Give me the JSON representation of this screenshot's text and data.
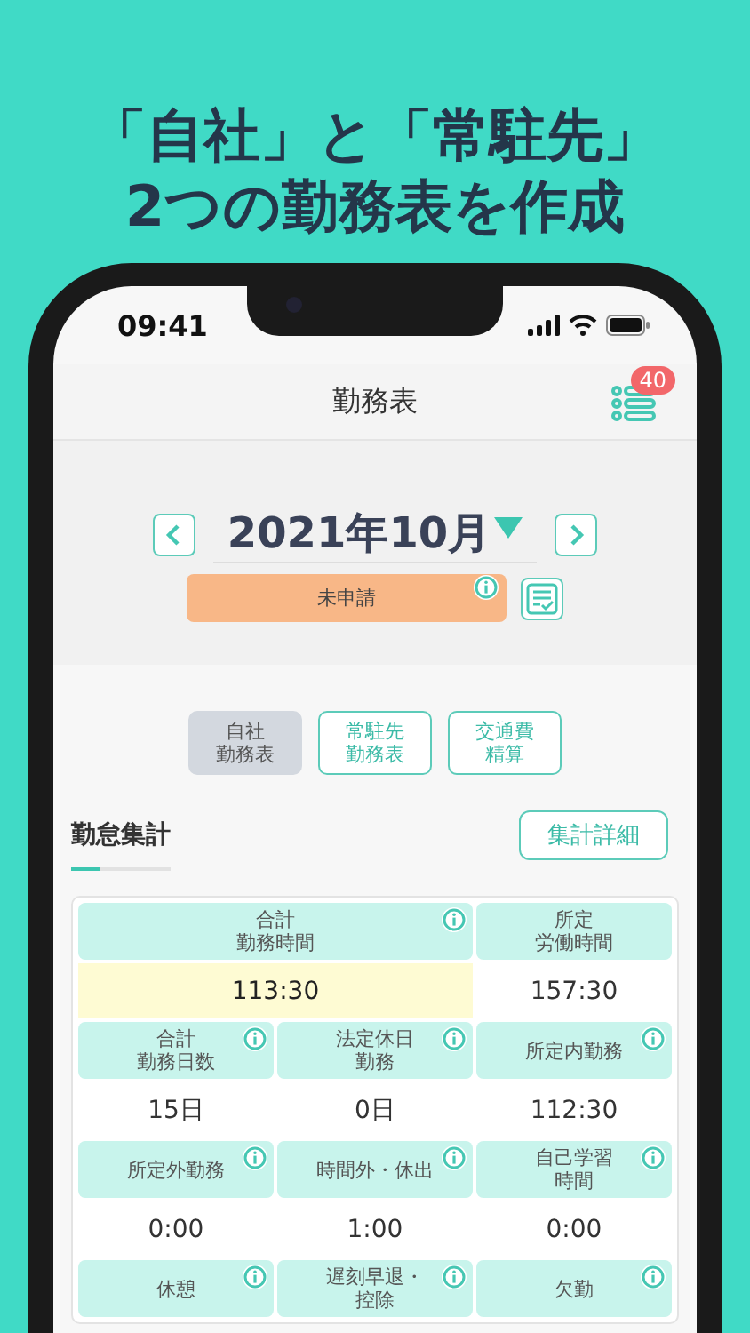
{
  "headline": [
    "「自社」と「常駐先」",
    "2つの勤務表を作成"
  ],
  "status_bar": {
    "time": "09:41"
  },
  "nav": {
    "title": "勤務表",
    "badge": "40"
  },
  "month": {
    "label": "2021年10月",
    "status": "未申請",
    "status_info": true
  },
  "tabs": [
    {
      "lines": [
        "自社",
        "勤務表"
      ],
      "selected": true
    },
    {
      "lines": [
        "常駐先",
        "勤務表"
      ],
      "selected": false
    },
    {
      "lines": [
        "交通費",
        "精算"
      ],
      "selected": false
    }
  ],
  "summary": {
    "title": "勤怠集計",
    "detail_button": "集計詳細",
    "rows": [
      [
        {
          "lines": [
            "合計",
            "勤務時間"
          ],
          "info": true,
          "value": "113:30",
          "highlight": true
        },
        "",
        {
          "lines": [
            "所定",
            "労働時間"
          ],
          "info": false,
          "value": "157:30",
          "highlight": false
        }
      ],
      [
        {
          "lines": [
            "合計",
            "勤務日数"
          ],
          "info": true,
          "value": "15日",
          "highlight": false
        },
        {
          "lines": [
            "法定休日",
            "勤務"
          ],
          "info": true,
          "value": "0日",
          "highlight": false
        },
        {
          "lines": [
            "所定内勤務"
          ],
          "info": true,
          "value": "112:30",
          "highlight": false
        }
      ],
      [
        {
          "lines": [
            "所定外勤務"
          ],
          "info": true,
          "value": "0:00",
          "highlight": false
        },
        {
          "lines": [
            "時間外・休出"
          ],
          "info": true,
          "value": "1:00",
          "highlight": false
        },
        {
          "lines": [
            "自己学習",
            "時間"
          ],
          "info": true,
          "value": "0:00",
          "highlight": false
        }
      ],
      [
        {
          "lines": [
            "休憩"
          ],
          "info": true
        },
        {
          "lines": [
            "遅刻早退・",
            "控除"
          ],
          "info": true
        },
        {
          "lines": [
            "欠勤"
          ],
          "info": true
        }
      ]
    ]
  }
}
